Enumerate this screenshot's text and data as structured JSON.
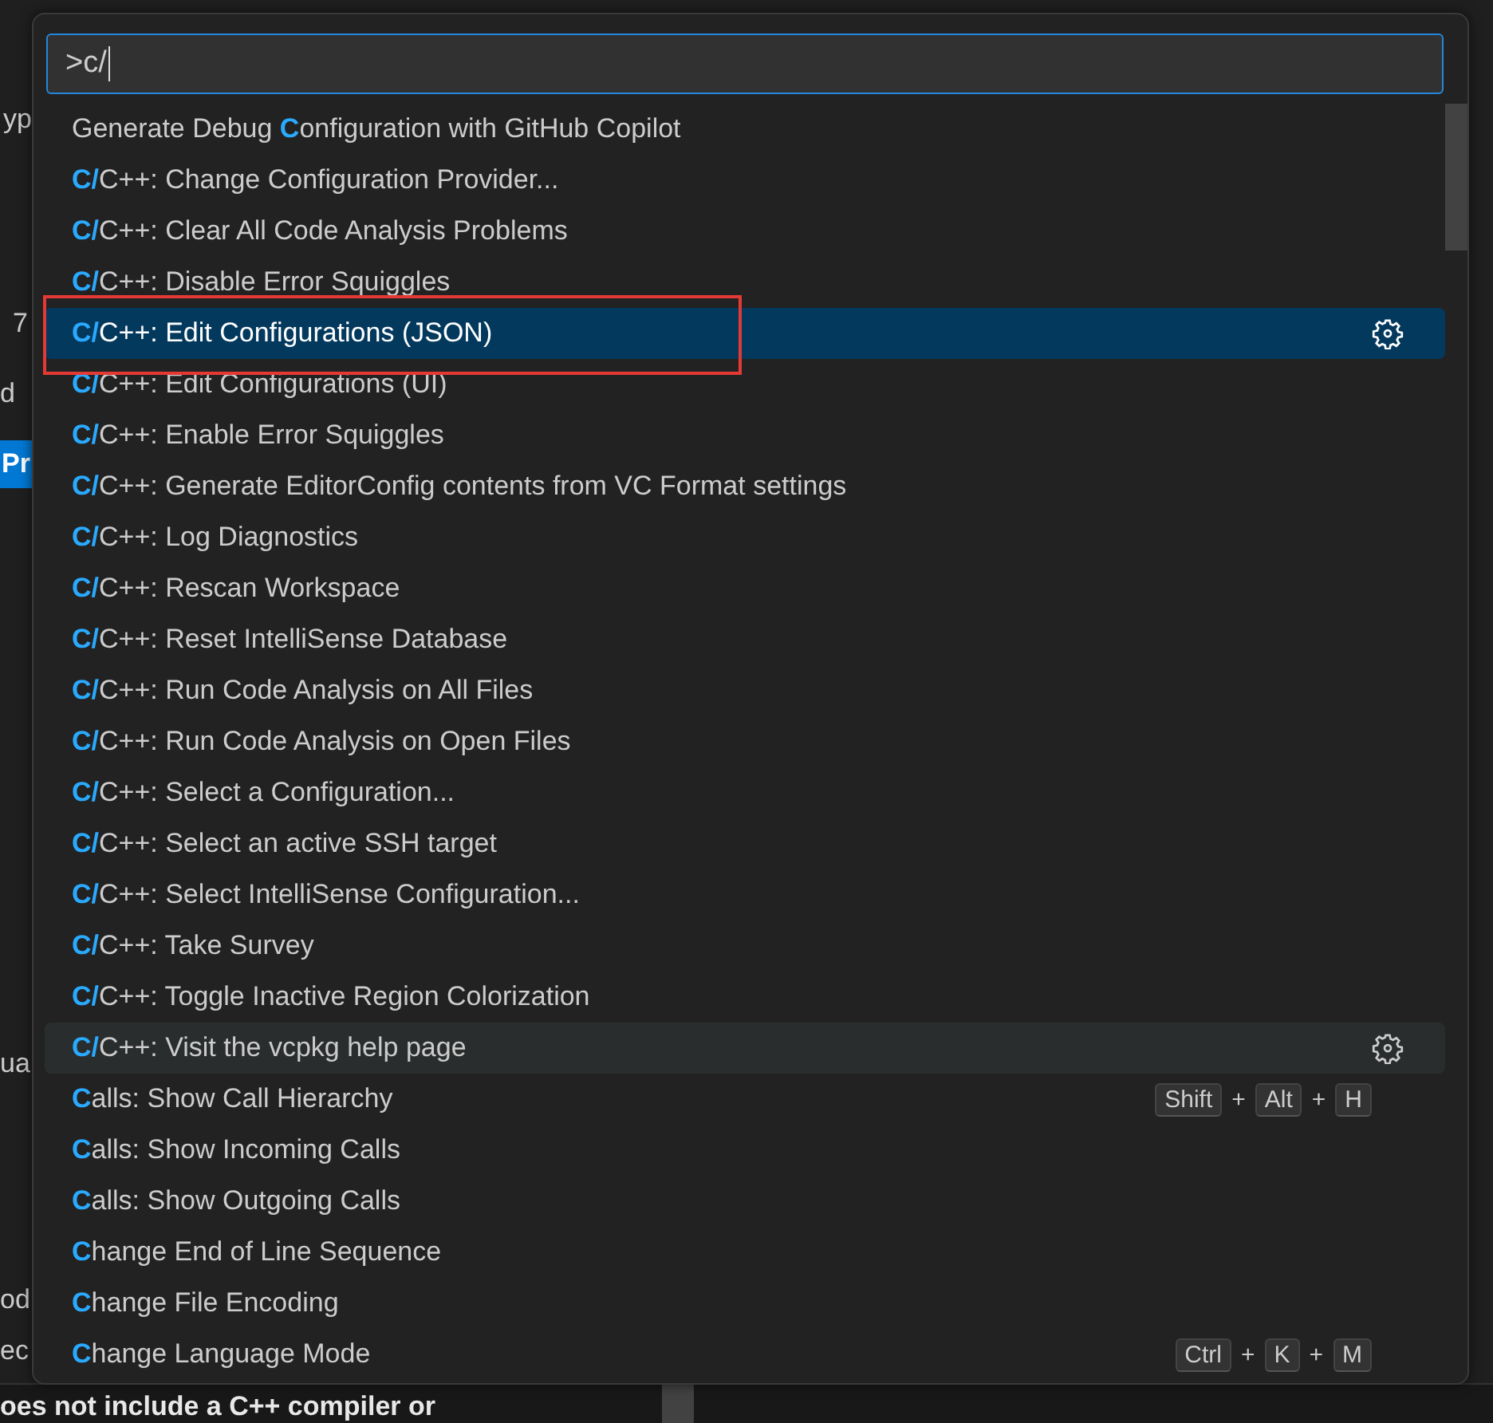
{
  "editor": {
    "fragments": [
      {
        "kind": "text",
        "text": "yp"
      },
      {
        "kind": "text",
        "text": "7"
      },
      {
        "kind": "text",
        "text": "d"
      },
      {
        "kind": "button",
        "text": "Pr"
      },
      {
        "kind": "text",
        "text": "ua"
      },
      {
        "kind": "text",
        "text": "od"
      },
      {
        "kind": "text",
        "text": "ec"
      },
      {
        "kind": "bold",
        "text": "oes not include a C++ compiler or"
      }
    ]
  },
  "palette": {
    "input": {
      "value": ">c/"
    },
    "items": [
      {
        "label": "Generate Debug **C**onfiguration with GitHub Copilot",
        "selected": false,
        "hovered": false,
        "gear": false,
        "boxed": false
      },
      {
        "label": "**C/**C++: Change Configuration Provider...",
        "selected": false,
        "hovered": false,
        "gear": false,
        "boxed": false
      },
      {
        "label": "**C/**C++: Clear All Code Analysis Problems",
        "selected": false,
        "hovered": false,
        "gear": false,
        "boxed": false
      },
      {
        "label": "**C/**C++: Disable Error Squiggles",
        "selected": false,
        "hovered": false,
        "gear": false,
        "boxed": false
      },
      {
        "label": "**C/**C++: Edit Configurations (JSON)",
        "selected": true,
        "hovered": false,
        "gear": true,
        "boxed": true
      },
      {
        "label": "**C/**C++: Edit Configurations (UI)",
        "selected": false,
        "hovered": false,
        "gear": false,
        "boxed": false
      },
      {
        "label": "**C/**C++: Enable Error Squiggles",
        "selected": false,
        "hovered": false,
        "gear": false,
        "boxed": false
      },
      {
        "label": "**C/**C++: Generate EditorConfig contents from VC Format settings",
        "selected": false,
        "hovered": false,
        "gear": false,
        "boxed": false
      },
      {
        "label": "**C/**C++: Log Diagnostics",
        "selected": false,
        "hovered": false,
        "gear": false,
        "boxed": false
      },
      {
        "label": "**C/**C++: Rescan Workspace",
        "selected": false,
        "hovered": false,
        "gear": false,
        "boxed": false
      },
      {
        "label": "**C/**C++: Reset IntelliSense Database",
        "selected": false,
        "hovered": false,
        "gear": false,
        "boxed": false
      },
      {
        "label": "**C/**C++: Run Code Analysis on All Files",
        "selected": false,
        "hovered": false,
        "gear": false,
        "boxed": false
      },
      {
        "label": "**C/**C++: Run Code Analysis on Open Files",
        "selected": false,
        "hovered": false,
        "gear": false,
        "boxed": false
      },
      {
        "label": "**C/**C++: Select a Configuration...",
        "selected": false,
        "hovered": false,
        "gear": false,
        "boxed": false
      },
      {
        "label": "**C/**C++: Select an active SSH target",
        "selected": false,
        "hovered": false,
        "gear": false,
        "boxed": false
      },
      {
        "label": "**C/**C++: Select IntelliSense Configuration...",
        "selected": false,
        "hovered": false,
        "gear": false,
        "boxed": false
      },
      {
        "label": "**C/**C++: Take Survey",
        "selected": false,
        "hovered": false,
        "gear": false,
        "boxed": false
      },
      {
        "label": "**C/**C++: Toggle Inactive Region Colorization",
        "selected": false,
        "hovered": false,
        "gear": false,
        "boxed": false
      },
      {
        "label": "**C/**C++: Visit the vcpkg help page",
        "selected": false,
        "hovered": true,
        "gear": true,
        "boxed": false
      },
      {
        "label": "**C**alls: Show Call Hierarchy",
        "selected": false,
        "hovered": false,
        "gear": false,
        "boxed": false,
        "keys": [
          "Shift",
          "Alt",
          "H"
        ],
        "key_separator": "+"
      },
      {
        "label": "**C**alls: Show Incoming Calls",
        "selected": false,
        "hovered": false,
        "gear": false,
        "boxed": false
      },
      {
        "label": "**C**alls: Show Outgoing Calls",
        "selected": false,
        "hovered": false,
        "gear": false,
        "boxed": false
      },
      {
        "label": "**C**hange End of Line Sequence",
        "selected": false,
        "hovered": false,
        "gear": false,
        "boxed": false
      },
      {
        "label": "**C**hange File Encoding",
        "selected": false,
        "hovered": false,
        "gear": false,
        "boxed": false
      },
      {
        "label": "**C**hange Language Mode",
        "selected": false,
        "hovered": false,
        "gear": false,
        "boxed": false,
        "keys": [
          "Ctrl",
          "K",
          "M"
        ],
        "key_separator": "+"
      }
    ]
  }
}
